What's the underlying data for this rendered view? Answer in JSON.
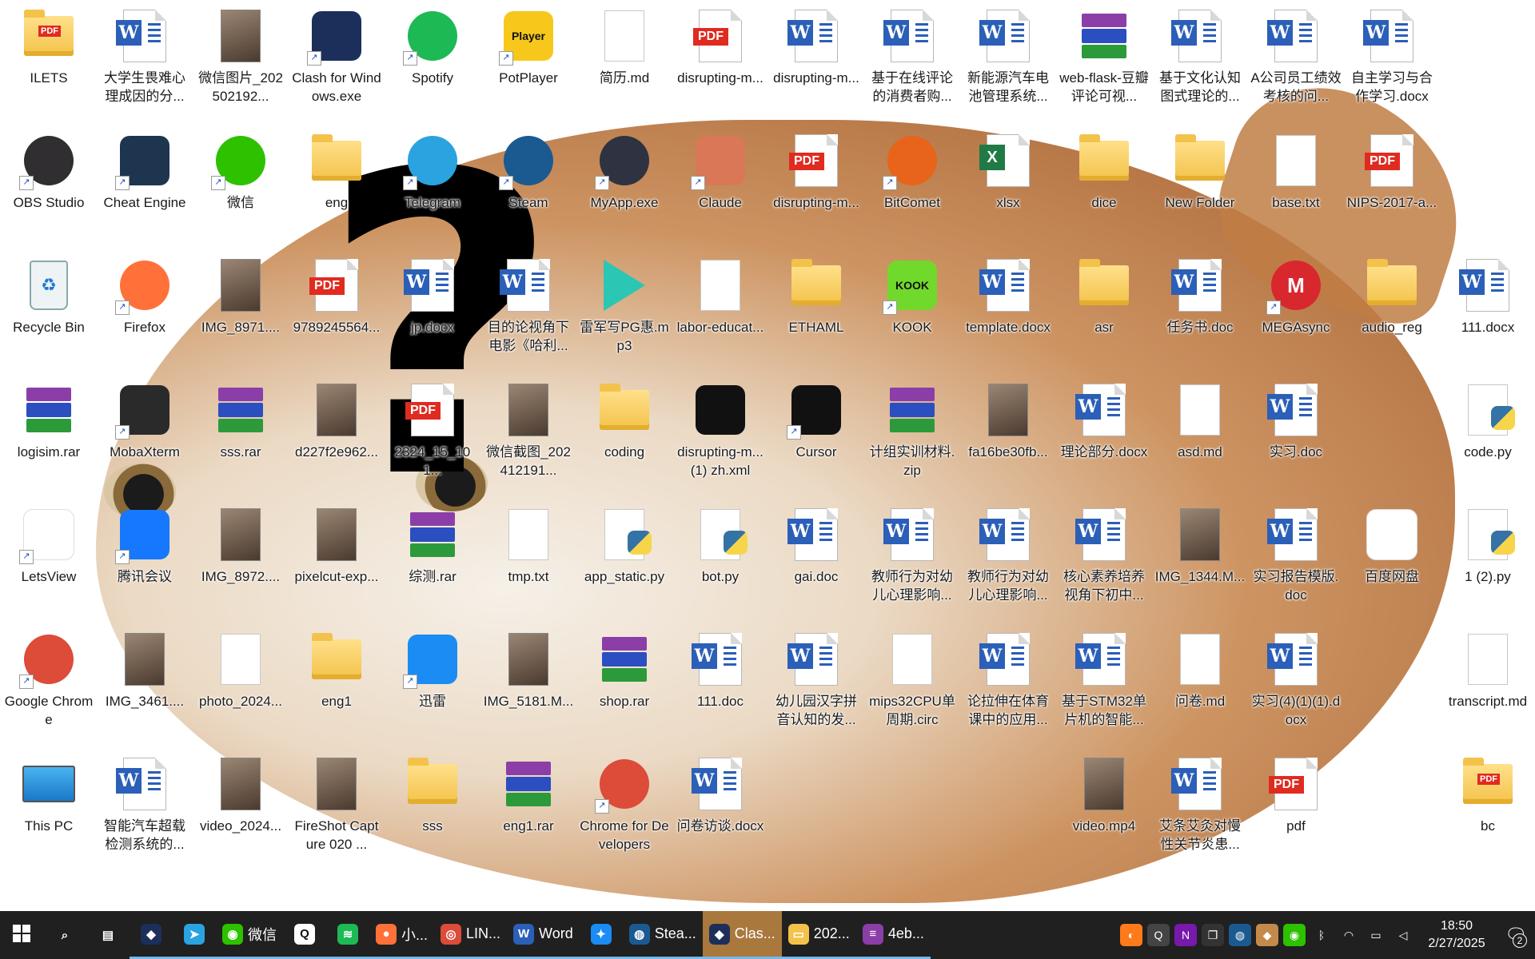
{
  "desktop": {
    "icons": [
      {
        "label": "ILETS",
        "type": "pdf-folder",
        "icon_name": "folder-pdf-icon",
        "shortcut": false
      },
      {
        "label": "大学生畏难心理成因的分...",
        "type": "word",
        "icon_name": "word-doc-icon",
        "shortcut": false
      },
      {
        "label": "微信图片_202502192...",
        "type": "image",
        "icon_name": "image-icon",
        "shortcut": false
      },
      {
        "label": "Clash for Windows.exe",
        "type": "app",
        "icon_name": "clash-cat-icon",
        "color": "#1c2f5a",
        "shortcut": true
      },
      {
        "label": "Spotify",
        "type": "round",
        "icon_name": "spotify-icon",
        "color": "#1db954",
        "shortcut": true
      },
      {
        "label": "PotPlayer",
        "type": "sq",
        "icon_name": "potplayer-icon",
        "color": "#f7c81b",
        "shortcut": true,
        "text": "Player"
      },
      {
        "label": "简历.md",
        "type": "txt",
        "icon_name": "markdown-file-icon",
        "shortcut": false
      },
      {
        "label": "disrupting-m...",
        "type": "pdf",
        "icon_name": "pdf-icon",
        "shortcut": false
      },
      {
        "label": "disrupting-m...",
        "type": "word",
        "icon_name": "word-doc-icon",
        "shortcut": false
      },
      {
        "label": "基于在线评论的消费者购...",
        "type": "word",
        "icon_name": "word-doc-icon",
        "shortcut": false
      },
      {
        "label": "新能源汽车电池管理系统...",
        "type": "word",
        "icon_name": "word-doc-icon",
        "shortcut": false
      },
      {
        "label": "web-flask-豆瓣评论可视...",
        "type": "rar",
        "icon_name": "winrar-icon",
        "shortcut": false
      },
      {
        "label": "基于文化认知图式理论的...",
        "type": "word",
        "icon_name": "word-doc-icon",
        "shortcut": false
      },
      {
        "label": "A公司员工绩效考核的问...",
        "type": "word",
        "icon_name": "word-doc-icon",
        "shortcut": false
      },
      {
        "label": "自主学习与合作学习.docx",
        "type": "word",
        "icon_name": "word-doc-icon",
        "shortcut": false
      },
      {
        "label": "OBS Studio",
        "type": "round",
        "icon_name": "obs-icon",
        "color": "#302e31",
        "shortcut": true
      },
      {
        "label": "Cheat Engine",
        "type": "app",
        "icon_name": "cheat-engine-icon",
        "color": "#1e3550",
        "shortcut": true
      },
      {
        "label": "微信",
        "type": "round",
        "icon_name": "wechat-icon",
        "color": "#2dc100",
        "shortcut": true
      },
      {
        "label": "eng",
        "type": "folder",
        "icon_name": "folder-icon",
        "shortcut": false
      },
      {
        "label": "Telegram",
        "type": "round",
        "icon_name": "telegram-icon",
        "color": "#2aa3e0",
        "shortcut": true
      },
      {
        "label": "Steam",
        "type": "round",
        "icon_name": "steam-icon",
        "color": "#1b5a91",
        "shortcut": true
      },
      {
        "label": "MyApp.exe",
        "type": "round",
        "icon_name": "electron-icon",
        "color": "#2f3241",
        "shortcut": true
      },
      {
        "label": "Claude",
        "type": "sq",
        "icon_name": "claude-icon",
        "color": "#d97757",
        "shortcut": true
      },
      {
        "label": "disrupting-m...",
        "type": "pdf",
        "icon_name": "pdf-icon",
        "shortcut": false
      },
      {
        "label": "BitComet",
        "type": "round",
        "icon_name": "bitcomet-icon",
        "color": "#e8641b",
        "shortcut": true
      },
      {
        "label": "xlsx",
        "type": "excel",
        "icon_name": "excel-icon",
        "shortcut": false
      },
      {
        "label": "dice",
        "type": "folder",
        "icon_name": "folder-icon",
        "shortcut": false
      },
      {
        "label": "New Folder",
        "type": "folder",
        "icon_name": "folder-icon",
        "shortcut": false
      },
      {
        "label": "base.txt",
        "type": "txt",
        "icon_name": "text-file-icon",
        "shortcut": false
      },
      {
        "label": "NIPS-2017-a...",
        "type": "pdf",
        "icon_name": "pdf-icon",
        "shortcut": false
      },
      {
        "label": "Recycle Bin",
        "type": "bin",
        "icon_name": "recycle-bin-icon",
        "shortcut": false
      },
      {
        "label": "Firefox",
        "type": "round",
        "icon_name": "firefox-icon",
        "color": "#ff7139",
        "shortcut": true
      },
      {
        "label": "IMG_8971....",
        "type": "image",
        "icon_name": "video-file-icon",
        "shortcut": false
      },
      {
        "label": "9789245564...",
        "type": "pdf",
        "icon_name": "pdf-icon",
        "shortcut": false
      },
      {
        "label": "jp.docx",
        "type": "word",
        "icon_name": "word-doc-icon",
        "shortcut": false
      },
      {
        "label": "目的论视角下电影《哈利...",
        "type": "word",
        "icon_name": "word-doc-icon",
        "shortcut": false
      },
      {
        "label": "雷军写PG惠.mp3",
        "type": "mp3",
        "icon_name": "mp3-play-icon",
        "color": "#2bc6b4",
        "shortcut": false
      },
      {
        "label": "labor-educat...",
        "type": "txt",
        "icon_name": "markdown-file-icon",
        "shortcut": false
      },
      {
        "label": "ETHAML",
        "type": "folder",
        "icon_name": "folder-icon",
        "shortcut": false
      },
      {
        "label": "KOOK",
        "type": "sq",
        "icon_name": "kook-icon",
        "color": "#71d92b",
        "shortcut": true,
        "text": "KOOK"
      },
      {
        "label": "template.docx",
        "type": "word",
        "icon_name": "word-doc-icon",
        "shortcut": false
      },
      {
        "label": "asr",
        "type": "folder",
        "icon_name": "folder-icon",
        "shortcut": false
      },
      {
        "label": "任务书.doc",
        "type": "word",
        "icon_name": "word-doc-icon",
        "shortcut": false
      },
      {
        "label": "MEGAsync",
        "type": "round",
        "icon_name": "mega-icon",
        "color": "#d9272e",
        "shortcut": true,
        "text": "M"
      },
      {
        "label": "audio_reg",
        "type": "folder",
        "icon_name": "folder-icon",
        "shortcut": false
      },
      {
        "label": "111.docx",
        "type": "word",
        "icon_name": "word-doc-icon",
        "shortcut": false
      },
      {
        "label": "logisim.rar",
        "type": "rar",
        "icon_name": "winrar-icon",
        "shortcut": false
      },
      {
        "label": "MobaXterm",
        "type": "app",
        "icon_name": "mobaxterm-icon",
        "color": "#2a2a2a",
        "shortcut": true
      },
      {
        "label": "sss.rar",
        "type": "rar",
        "icon_name": "winrar-icon",
        "shortcut": false
      },
      {
        "label": "d227f2e962...",
        "type": "image",
        "icon_name": "image-icon",
        "shortcut": false
      },
      {
        "label": "2324_15_101...",
        "type": "pdf",
        "icon_name": "pdf-icon",
        "shortcut": false
      },
      {
        "label": "微信截图_202412191...",
        "type": "image",
        "icon_name": "image-icon",
        "shortcut": false
      },
      {
        "label": "coding",
        "type": "folder",
        "icon_name": "folder-icon",
        "shortcut": false
      },
      {
        "label": "disrupting-m...(1) zh.xml",
        "type": "sq",
        "icon_name": "cube-app-icon",
        "color": "#111111",
        "shortcut": false
      },
      {
        "label": "Cursor",
        "type": "sq",
        "icon_name": "cursor-icon",
        "color": "#111111",
        "shortcut": true
      },
      {
        "label": "计组实训材料.zip",
        "type": "rar",
        "icon_name": "winrar-icon",
        "shortcut": false
      },
      {
        "label": "fa16be30fb...",
        "type": "image",
        "icon_name": "mindmap-image-icon",
        "shortcut": false
      },
      {
        "label": "理论部分.docx",
        "type": "word",
        "icon_name": "word-doc-icon",
        "shortcut": false
      },
      {
        "label": "asd.md",
        "type": "txt",
        "icon_name": "markdown-file-icon",
        "shortcut": false
      },
      {
        "label": "实习.doc",
        "type": "word",
        "icon_name": "word-doc-icon",
        "shortcut": false
      },
      {
        "label": "code.py",
        "type": "py",
        "icon_name": "python-file-icon",
        "shortcut": false
      },
      {
        "label": "LetsView",
        "type": "sq",
        "icon_name": "letsview-icon",
        "color": "#ffffff",
        "shortcut": true
      },
      {
        "label": "腾讯会议",
        "type": "sq",
        "icon_name": "tencent-meeting-icon",
        "color": "#1677ff",
        "shortcut": true
      },
      {
        "label": "IMG_8972....",
        "type": "image",
        "icon_name": "video-file-icon",
        "shortcut": false
      },
      {
        "label": "pixelcut-exp...",
        "type": "image",
        "icon_name": "image-icon",
        "shortcut": false
      },
      {
        "label": "综测.rar",
        "type": "rar",
        "icon_name": "winrar-icon",
        "shortcut": false
      },
      {
        "label": "tmp.txt",
        "type": "txt",
        "icon_name": "text-file-icon",
        "shortcut": false
      },
      {
        "label": "app_static.py",
        "type": "py",
        "icon_name": "python-file-icon",
        "shortcut": false
      },
      {
        "label": "bot.py",
        "type": "py",
        "icon_name": "python-file-icon",
        "shortcut": false
      },
      {
        "label": "gai.doc",
        "type": "word",
        "icon_name": "word-doc-icon",
        "shortcut": false
      },
      {
        "label": "教师行为对幼儿心理影响...",
        "type": "word",
        "icon_name": "word-doc-icon",
        "shortcut": false
      },
      {
        "label": "教师行为对幼儿心理影响...",
        "type": "word",
        "icon_name": "word-doc-icon",
        "shortcut": false
      },
      {
        "label": "核心素养培养视角下初中...",
        "type": "word",
        "icon_name": "word-doc-icon",
        "shortcut": false
      },
      {
        "label": "IMG_1344.M...",
        "type": "image",
        "icon_name": "video-file-icon",
        "shortcut": false
      },
      {
        "label": "实习报告模版.doc",
        "type": "word",
        "icon_name": "word-doc-icon",
        "shortcut": false
      },
      {
        "label": "百度网盘",
        "type": "sq",
        "icon_name": "baidu-netdisk-icon",
        "color": "#ffffff",
        "shortcut": false
      },
      {
        "label": "1 (2).py",
        "type": "py",
        "icon_name": "python-file-icon",
        "shortcut": false
      },
      {
        "label": "Google Chrome",
        "type": "round",
        "icon_name": "chrome-icon",
        "color": "#dd4b39",
        "shortcut": true
      },
      {
        "label": "IMG_3461....",
        "type": "image",
        "icon_name": "video-file-icon",
        "shortcut": false
      },
      {
        "label": "photo_2024...",
        "type": "txt",
        "icon_name": "image-icon",
        "shortcut": false
      },
      {
        "label": "eng1",
        "type": "folder",
        "icon_name": "folder-icon",
        "shortcut": false
      },
      {
        "label": "迅雷",
        "type": "sq",
        "icon_name": "xunlei-icon",
        "color": "#1b8cf3",
        "shortcut": true
      },
      {
        "label": "IMG_5181.M...",
        "type": "image",
        "icon_name": "video-file-icon",
        "shortcut": false
      },
      {
        "label": "shop.rar",
        "type": "rar",
        "icon_name": "winrar-icon",
        "shortcut": false
      },
      {
        "label": "111.doc",
        "type": "word",
        "icon_name": "word-doc-icon",
        "shortcut": false
      },
      {
        "label": "幼儿园汉字拼音认知的发...",
        "type": "word",
        "icon_name": "word-doc-icon",
        "shortcut": false
      },
      {
        "label": "mips32CPU单周期.circ",
        "type": "txt",
        "icon_name": "blank-file-icon",
        "shortcut": false
      },
      {
        "label": "论拉伸在体育课中的应用...",
        "type": "word",
        "icon_name": "word-doc-icon",
        "shortcut": false
      },
      {
        "label": "基于STM32单片机的智能...",
        "type": "word",
        "icon_name": "word-doc-icon",
        "shortcut": false
      },
      {
        "label": "问卷.md",
        "type": "txt",
        "icon_name": "markdown-file-icon",
        "shortcut": false
      },
      {
        "label": "实习(4)(1)(1).docx",
        "type": "word",
        "icon_name": "word-doc-icon",
        "shortcut": false
      },
      {
        "label": "transcript.md",
        "type": "txt",
        "icon_name": "markdown-file-icon",
        "shortcut": false
      },
      {
        "label": "This PC",
        "type": "pc",
        "icon_name": "computer-icon",
        "shortcut": false
      },
      {
        "label": "智能汽车超载检测系统的...",
        "type": "word",
        "icon_name": "word-doc-icon",
        "shortcut": false
      },
      {
        "label": "video_2024...",
        "type": "image",
        "icon_name": "video-file-icon",
        "shortcut": false
      },
      {
        "label": "FireShot Capture 020 ...",
        "type": "image",
        "icon_name": "screenshot-file-icon",
        "shortcut": false
      },
      {
        "label": "sss",
        "type": "folder",
        "icon_name": "folder-icon",
        "shortcut": false
      },
      {
        "label": "eng1.rar",
        "type": "rar",
        "icon_name": "winrar-icon",
        "shortcut": false
      },
      {
        "label": "Chrome for Developers",
        "type": "round",
        "icon_name": "chrome-icon",
        "color": "#dd4b39",
        "shortcut": true
      },
      {
        "label": "问卷访谈.docx",
        "type": "word",
        "icon_name": "word-doc-icon",
        "shortcut": false
      },
      {
        "label": "video.mp4",
        "type": "image",
        "icon_name": "video-file-icon",
        "shortcut": false
      },
      {
        "label": "艾条艾灸对慢性关节炎患...",
        "type": "word",
        "icon_name": "word-doc-icon",
        "shortcut": false
      },
      {
        "label": "pdf",
        "type": "pdf",
        "icon_name": "pdf-icon",
        "shortcut": false
      },
      {
        "label": "bc",
        "type": "pdf-folder",
        "icon_name": "folder-pdf-icon",
        "shortcut": false
      }
    ]
  },
  "taskbar": {
    "start_icon": "windows-start-icon",
    "items": [
      {
        "label": "",
        "icon_name": "search-icon",
        "color": "#202020",
        "app": false,
        "active": false,
        "glyph": "⌕"
      },
      {
        "label": "",
        "icon_name": "task-view-icon",
        "color": "#202020",
        "app": false,
        "active": false,
        "glyph": "▤"
      },
      {
        "label": "",
        "icon_name": "clash-cat-icon",
        "color": "#1c2f5a",
        "app": true,
        "active": false,
        "glyph": "◆"
      },
      {
        "label": "",
        "icon_name": "telegram-icon",
        "color": "#2aa3e0",
        "app": true,
        "active": false,
        "glyph": "➤"
      },
      {
        "label": "微信",
        "icon_name": "wechat-icon",
        "color": "#2dc100",
        "app": true,
        "active": false,
        "glyph": "◉"
      },
      {
        "label": "",
        "icon_name": "qq-icon",
        "color": "#ffffff",
        "app": true,
        "active": false,
        "glyph": "Q"
      },
      {
        "label": "",
        "icon_name": "spotify-icon",
        "color": "#1db954",
        "app": true,
        "active": false,
        "glyph": "≋"
      },
      {
        "label": "小...",
        "icon_name": "firefox-icon",
        "color": "#ff7139",
        "app": true,
        "active": false,
        "glyph": "●"
      },
      {
        "label": "LIN...",
        "icon_name": "chrome-icon",
        "color": "#dd4b39",
        "app": true,
        "active": false,
        "glyph": "◎"
      },
      {
        "label": "Word",
        "icon_name": "word-icon",
        "color": "#2b5fb8",
        "app": true,
        "active": false,
        "glyph": "W"
      },
      {
        "label": "",
        "icon_name": "xunlei-icon",
        "color": "#1b8cf3",
        "app": true,
        "active": false,
        "glyph": "✦"
      },
      {
        "label": "Stea...",
        "icon_name": "steam-icon",
        "color": "#1b5a91",
        "app": true,
        "active": false,
        "glyph": "◍"
      },
      {
        "label": "Clas...",
        "icon_name": "clash-cat-icon",
        "color": "#1c2f5a",
        "app": true,
        "active": true,
        "glyph": "◆"
      },
      {
        "label": "202...",
        "icon_name": "folder-icon",
        "color": "#f3c24a",
        "app": true,
        "active": false,
        "glyph": "▭"
      },
      {
        "label": "4eb...",
        "icon_name": "winrar-icon",
        "color": "#8b3ea8",
        "app": true,
        "active": false,
        "glyph": "≡"
      }
    ],
    "tray": [
      {
        "icon_name": "tray-app-icon",
        "color": "#ff7a1a",
        "glyph": "◐"
      },
      {
        "icon_name": "qq-tray-icon",
        "color": "#444444",
        "glyph": "Q"
      },
      {
        "icon_name": "onenote-icon",
        "color": "#7719aa",
        "glyph": "N"
      },
      {
        "icon_name": "window-switch-icon",
        "color": "#333333",
        "glyph": "❐"
      },
      {
        "icon_name": "steam-tray-icon",
        "color": "#1b5a91",
        "glyph": "◍"
      },
      {
        "icon_name": "cat-tray-icon",
        "color": "#c48a4a",
        "glyph": "◆"
      },
      {
        "icon_name": "wechat-tray-icon",
        "color": "#2dc100",
        "glyph": "◉"
      },
      {
        "icon_name": "bluetooth-icon",
        "color": "#202020",
        "glyph": "ᛒ"
      },
      {
        "icon_name": "wifi-icon",
        "color": "#202020",
        "glyph": "◠"
      },
      {
        "icon_name": "battery-icon",
        "color": "#202020",
        "glyph": "▭"
      },
      {
        "icon_name": "volume-icon",
        "color": "#202020",
        "glyph": "◁"
      }
    ],
    "clock": {
      "time": "18:50",
      "date": "2/27/2025"
    },
    "notifications": {
      "count": "2"
    }
  }
}
